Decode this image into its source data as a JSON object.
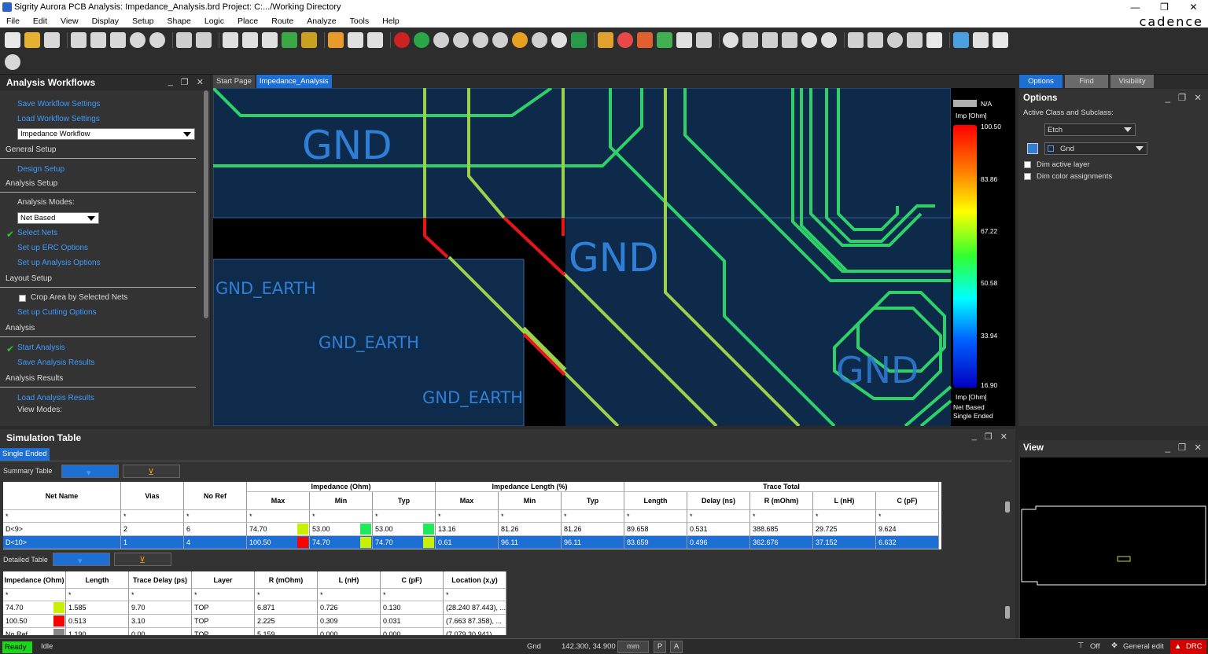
{
  "window": {
    "title": "Sigrity Aurora PCB Analysis: Impedance_Analysis.brd  Project: C:.../Working Directory",
    "controls": [
      "minimize",
      "restore",
      "close"
    ]
  },
  "menu": {
    "items": [
      "File",
      "Edit",
      "View",
      "Display",
      "Setup",
      "Shape",
      "Logic",
      "Place",
      "Route",
      "Analyze",
      "Tools",
      "Help"
    ],
    "brand": "cadence"
  },
  "workflow": {
    "title": "Analysis Workflows",
    "save_settings": "Save Workflow Settings",
    "load_settings": "Load Workflow Settings",
    "workflow_selected": "Impedance Workflow",
    "general_setup": "General Setup",
    "design_setup": "Design Setup",
    "analysis_setup": "Analysis Setup",
    "analysis_modes_label": "Analysis Modes:",
    "analysis_mode_value": "Net Based",
    "select_nets": "Select Nets",
    "erc_options": "Set up ERC Options",
    "analysis_options": "Set up Analysis Options",
    "layout_setup": "Layout Setup",
    "crop_area": "Crop Area by Selected Nets",
    "cutting_options": "Set up Cutting Options",
    "analysis": "Analysis",
    "start_analysis": "Start Analysis",
    "save_results": "Save Analysis Results",
    "analysis_results": "Analysis Results",
    "load_results": "Load Analysis Results",
    "view_modes": "View Modes:"
  },
  "canvas_tabs": [
    "Start Page",
    "Impedance_Analysis"
  ],
  "canvas": {
    "labels": [
      "GND",
      "GND",
      "GND_EARTH",
      "GND_EARTH",
      "GND_EARTH",
      "GND"
    ]
  },
  "legend": {
    "na": "N/A",
    "unit": "Imp [Ohm]",
    "ticks": [
      "100.50",
      "83.86",
      "67.22",
      "50.58",
      "33.94",
      "16.90"
    ],
    "footer_unit": "Imp [Ohm]",
    "footer_mode": "Net Based",
    "footer_type": "Single Ended"
  },
  "options": {
    "tabs": [
      "Options",
      "Find",
      "Visibility"
    ],
    "title": "Options",
    "class_label": "Active Class and Subclass:",
    "class_value": "Etch",
    "subclass_value": "Gnd",
    "dim_active": "Dim active layer",
    "dim_color": "Dim color assignments"
  },
  "view": {
    "title": "View"
  },
  "simulation": {
    "title": "Simulation Table",
    "tab": "Single Ended",
    "summary_label": "Summary Table",
    "detailed_label": "Detailed Table",
    "group_headers": [
      "Impedance (Ohm)",
      "Impedance Length (%)",
      "Trace Total"
    ],
    "columns": [
      "Net Name",
      "Vias",
      "No Ref",
      "Max",
      "Min",
      "Typ",
      "Max",
      "Min",
      "Typ",
      "Length",
      "Delay (ns)",
      "R (mOhm)",
      "L (nH)",
      "C (pF)"
    ],
    "filter": "*",
    "rows": [
      {
        "cells": [
          "D<9>",
          "2",
          "6",
          "74.70",
          "53.00",
          "53.00",
          "13.16",
          "81.26",
          "81.26",
          "89.658",
          "0.531",
          "388.685",
          "29.725",
          "9.624"
        ],
        "swatches": [
          "#c8f000",
          "#22e85a",
          "#22e85a"
        ],
        "selected": false
      },
      {
        "cells": [
          "D<10>",
          "1",
          "4",
          "100.50",
          "74.70",
          "74.70",
          "0.61",
          "96.11",
          "96.11",
          "83.659",
          "0.496",
          "362.676",
          "37.152",
          "6.632"
        ],
        "swatches": [
          "#ff0000",
          "#c8f000",
          "#c8f000"
        ],
        "selected": true
      }
    ],
    "detail_columns": [
      "Impedance (Ohm)",
      "Length",
      "Trace Delay (ps)",
      "Layer",
      "R (mOhm)",
      "L (nH)",
      "C (pF)",
      "Location (x,y)"
    ],
    "detail_rows": [
      {
        "cells": [
          "74.70",
          "1.585",
          "9.70",
          "TOP",
          "6.871",
          "0.726",
          "0.130",
          "(28.240 87.443), ..."
        ],
        "swatch": "#c8f000"
      },
      {
        "cells": [
          "100.50",
          "0.513",
          "3.10",
          "TOP",
          "2.225",
          "0.309",
          "0.031",
          "(7.663 87.358), ..."
        ],
        "swatch": "#ff0000"
      },
      {
        "cells": [
          "No Ref",
          "1.190",
          "0.00",
          "TOP",
          "5.159",
          "0.000",
          "0.000",
          "(7.079 30.941)"
        ],
        "swatch": "#888888"
      }
    ]
  },
  "status": {
    "ready": "Ready",
    "state": "Idle",
    "net": "Gnd",
    "coords": "142.300, 34.900",
    "units": "mm",
    "p_btn": "P",
    "a_btn": "A",
    "filter": "Off",
    "mode": "General edit",
    "drc": "DRC"
  },
  "colors": {
    "accent": "#1e6fd4",
    "link": "#3d9bff",
    "copper": "#0e2a4a",
    "trace_green": "#2ed068",
    "trace_yellowgreen": "#9ad04a",
    "trace_red": "#e8141c",
    "ready": "#1bd61b",
    "drc": "#d40000"
  }
}
